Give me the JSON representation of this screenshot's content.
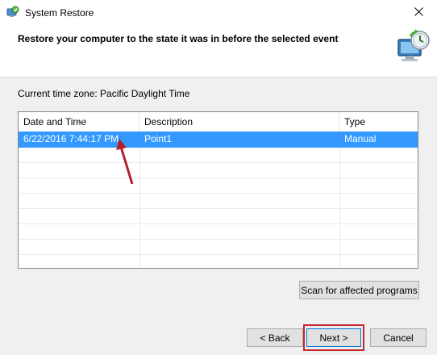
{
  "window": {
    "title": "System Restore"
  },
  "header": {
    "heading": "Restore your computer to the state it was in before the selected event"
  },
  "timezone_label": "Current time zone: Pacific Daylight Time",
  "table": {
    "columns": [
      "Date and Time",
      "Description",
      "Type"
    ],
    "sort_column": "Date and Time",
    "rows": [
      {
        "date": "6/22/2016 7:44:17 PM",
        "description": "Point1",
        "type": "Manual",
        "selected": true
      }
    ]
  },
  "buttons": {
    "scan": "Scan for affected programs",
    "back": "< Back",
    "next": "Next >",
    "cancel": "Cancel"
  },
  "colors": {
    "selection": "#3399ff",
    "annotation": "#c4262e",
    "accent": "#0078d7"
  },
  "icons": {
    "app": "system-restore-icon",
    "close": "close-icon",
    "header": "restore-computer-icon",
    "sort": "sort-caret-icon",
    "annotation": "red-arrow-annotation"
  }
}
